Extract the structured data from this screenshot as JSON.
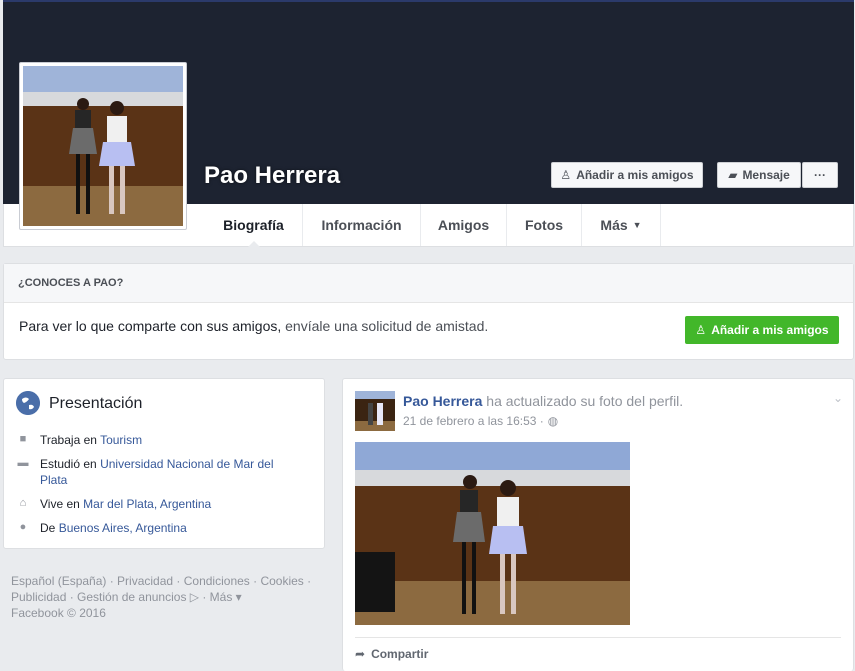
{
  "profile": {
    "name": "Pao Herrera",
    "buttons": {
      "add_friend": "Añadir a mis amigos",
      "message": "Mensaje",
      "more": "···"
    }
  },
  "tabs": [
    {
      "label": "Biografía",
      "active": true
    },
    {
      "label": "Información"
    },
    {
      "label": "Amigos"
    },
    {
      "label": "Fotos"
    },
    {
      "label": "Más"
    }
  ],
  "know": {
    "header": "¿CONOCES A PAO?",
    "text_main": "Para ver lo que comparte con sus amigos,",
    "text_light": "envíale una solicitud de amistad.",
    "button": "Añadir a mis amigos"
  },
  "intro": {
    "title": "Presentación",
    "work": {
      "prefix": "Trabaja en",
      "link": "Tourism"
    },
    "study": {
      "prefix": "Estudió en",
      "link": "Universidad Nacional de Mar del Plata"
    },
    "lives": {
      "prefix": "Vive en",
      "link": "Mar del Plata, Argentina"
    },
    "from": {
      "prefix": "De",
      "link": "Buenos Aires, Argentina"
    }
  },
  "footer": {
    "line1": "Español (España) · Privacidad · Condiciones · Cookies ·",
    "line2": "Publicidad · Gestión de anuncios ▷ · Más ▾",
    "line3": "Facebook © 2016"
  },
  "post": {
    "author": "Pao Herrera",
    "action": "ha actualizado su foto del perfil.",
    "date": "21 de febrero a las 16:53 ·",
    "share": "Compartir"
  },
  "colors": {
    "cover": "#1d2331",
    "link": "#365899",
    "green": "#42b72a"
  }
}
